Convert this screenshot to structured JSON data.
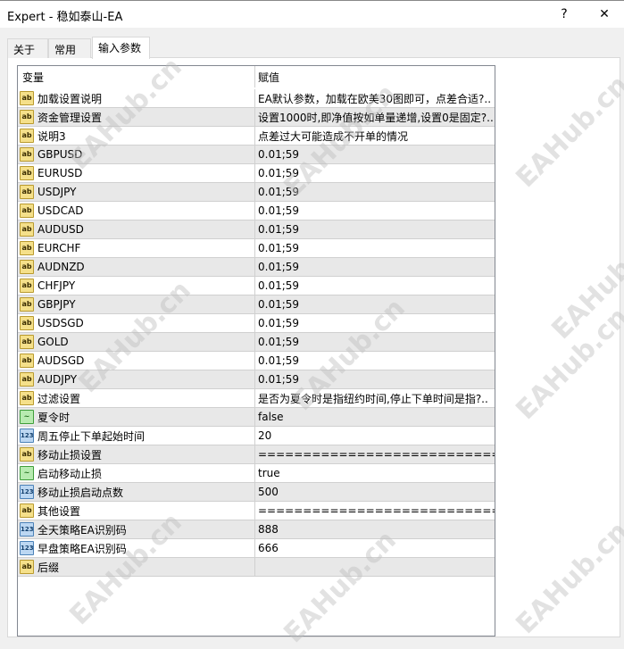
{
  "window": {
    "title": "Expert - 稳如泰山-EA",
    "help": "?",
    "close": "✕"
  },
  "tabs": [
    {
      "label": "关于"
    },
    {
      "label": "常用"
    },
    {
      "label": "输入参数"
    }
  ],
  "table": {
    "headers": {
      "variable": "变量",
      "value": "赋值"
    },
    "rows": [
      {
        "icon": "ab",
        "name": "加载设置说明",
        "value": "EA默认参数，加载在欧美30图即可，点差合适?.."
      },
      {
        "icon": "ab",
        "name": "资金管理设置",
        "value": "设置1000时,即净值按如单量递增,设置0是固定?.."
      },
      {
        "icon": "ab",
        "name": "说明3",
        "value": "点差过大可能造成不开单的情况"
      },
      {
        "icon": "ab",
        "name": "GBPUSD",
        "value": "0.01;59"
      },
      {
        "icon": "ab",
        "name": "EURUSD",
        "value": "0.01;59"
      },
      {
        "icon": "ab",
        "name": "USDJPY",
        "value": "0.01;59"
      },
      {
        "icon": "ab",
        "name": "USDCAD",
        "value": "0.01;59"
      },
      {
        "icon": "ab",
        "name": "AUDUSD",
        "value": "0.01;59"
      },
      {
        "icon": "ab",
        "name": "EURCHF",
        "value": "0.01;59"
      },
      {
        "icon": "ab",
        "name": "AUDNZD",
        "value": "0.01;59"
      },
      {
        "icon": "ab",
        "name": "CHFJPY",
        "value": "0.01;59"
      },
      {
        "icon": "ab",
        "name": "GBPJPY",
        "value": "0.01;59"
      },
      {
        "icon": "ab",
        "name": "USDSGD",
        "value": "0.01;59"
      },
      {
        "icon": "ab",
        "name": "GOLD",
        "value": "0.01;59"
      },
      {
        "icon": "ab",
        "name": "AUDSGD",
        "value": "0.01;59"
      },
      {
        "icon": "ab",
        "name": "AUDJPY",
        "value": "0.01;59"
      },
      {
        "icon": "ab",
        "name": "过滤设置",
        "value": "是否为夏令时是指纽约时间,停止下单时间是指?.."
      },
      {
        "icon": "bool",
        "name": "夏令时",
        "value": "false"
      },
      {
        "icon": "123",
        "name": "周五停止下单起始时间",
        "value": "20"
      },
      {
        "icon": "ab",
        "name": "移动止损设置",
        "value": "================================..."
      },
      {
        "icon": "bool",
        "name": "启动移动止损",
        "value": "true"
      },
      {
        "icon": "123",
        "name": "移动止损启动点数",
        "value": "500"
      },
      {
        "icon": "ab",
        "name": "其他设置",
        "value": "================================..."
      },
      {
        "icon": "123",
        "name": "全天策略EA识别码",
        "value": "888"
      },
      {
        "icon": "123",
        "name": "早盘策略EA识别码",
        "value": "666"
      },
      {
        "icon": "ab",
        "name": "后缀",
        "value": ""
      }
    ]
  },
  "icon_labels": {
    "ab": "ab",
    "123": "123",
    "bool": "~"
  },
  "watermark": "EAHub.cn"
}
